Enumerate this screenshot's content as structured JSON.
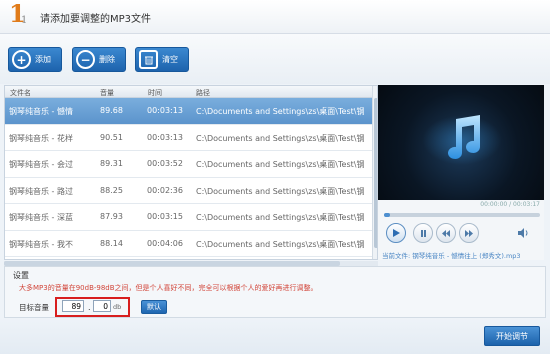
{
  "header": {
    "step_big": "1",
    "step_small": "1",
    "title": "请添加要调整的MP3文件"
  },
  "toolbar": {
    "add_label": "添加",
    "delete_label": "删除",
    "clear_label": "清空"
  },
  "list": {
    "columns": [
      "文件名",
      "音量",
      "时间",
      "路径"
    ],
    "rows": [
      {
        "name": "钢琴纯音乐 - 憾情",
        "volume": "89.68",
        "time": "00:03:13",
        "path": "C:\\Documents and Settings\\zs\\桌面\\Test\\钢",
        "selected": true
      },
      {
        "name": "钢琴纯音乐 - 花样",
        "volume": "90.51",
        "time": "00:03:13",
        "path": "C:\\Documents and Settings\\zs\\桌面\\Test\\钢",
        "selected": false
      },
      {
        "name": "钢琴纯音乐 - 会过",
        "volume": "89.31",
        "time": "00:03:52",
        "path": "C:\\Documents and Settings\\zs\\桌面\\Test\\钢",
        "selected": false
      },
      {
        "name": "钢琴纯音乐 - 路过",
        "volume": "88.25",
        "time": "00:02:36",
        "path": "C:\\Documents and Settings\\zs\\桌面\\Test\\钢",
        "selected": false
      },
      {
        "name": "钢琴纯音乐 - 深蓝",
        "volume": "87.93",
        "time": "00:03:15",
        "path": "C:\\Documents and Settings\\zs\\桌面\\Test\\钢",
        "selected": false
      },
      {
        "name": "钢琴纯音乐 - 我不",
        "volume": "88.14",
        "time": "00:04:06",
        "path": "C:\\Documents and Settings\\zs\\桌面\\Test\\钢",
        "selected": false
      }
    ]
  },
  "player": {
    "time_display": "00:00:00 / 00:03:17",
    "now_playing": "当前文件: 钢琴纯音乐 - 憾情往上 (郑秀文).mp3",
    "progress_fraction": 0.04
  },
  "settings": {
    "title": "设置",
    "description": "大多MP3的音量在90dB-98dB之间，但是个人喜好不同，完全可以根据个人的爱好再进行调整。",
    "target_label": "目标音量",
    "volume_int": "89",
    "dot": ".",
    "volume_dec": "0",
    "unit": "db",
    "default_label": "默认"
  },
  "footer": {
    "start_label": "开始调节"
  },
  "colors": {
    "accent": "#1d63ad",
    "selection": "#6aa2d6",
    "highlight": "#d81e1e",
    "description": "#d2463a"
  }
}
